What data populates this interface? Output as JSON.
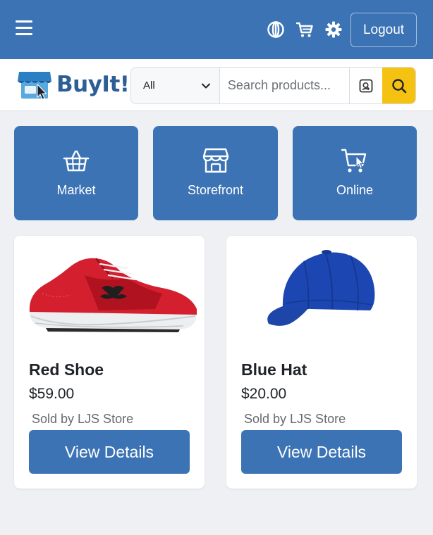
{
  "topbar": {
    "logout_label": "Logout"
  },
  "brand": {
    "name": "BuyIt!",
    "accent_color": "#3c73b4",
    "search_button_color": "#f5c211"
  },
  "search": {
    "category_selected": "All",
    "placeholder": "Search products..."
  },
  "categories": [
    {
      "label": "Market",
      "icon": "basket-icon"
    },
    {
      "label": "Storefront",
      "icon": "storefront-icon"
    },
    {
      "label": "Online",
      "icon": "online-cart-icon"
    }
  ],
  "products": [
    {
      "name": "Red Shoe",
      "price": "$59.00",
      "seller": "Sold by LJS Store",
      "button_label": "View Details",
      "image": "red-shoe-image"
    },
    {
      "name": "Blue Hat",
      "price": "$20.00",
      "seller": "Sold by LJS Store",
      "button_label": "View Details",
      "image": "blue-hat-image"
    }
  ]
}
